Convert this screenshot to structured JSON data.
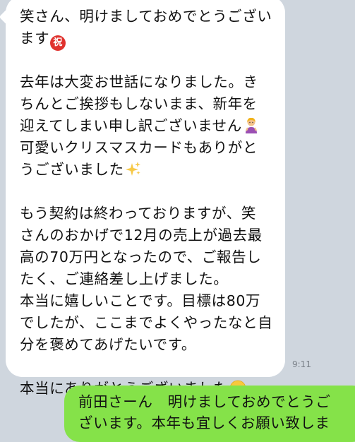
{
  "incoming": {
    "lines": [
      "笑さん、明けましておめでとうござい",
      "ます",
      "",
      "去年は大変お世話になりました。き",
      "ちんとご挨拶もしないまま、新年を",
      "迎えてしまい申し訳ございません",
      "可愛いクリスマスカードもありがと",
      "うございました",
      "",
      "もう契約は終わっておりますが、笑",
      "さんのおかげで12月の売上が過去最",
      "高の70万円となったので、ご報告し",
      "たく、ご連絡差し上げました。",
      "本当に嬉しいことです。目標は80万",
      "でしたが、ここまでよくやったなと自",
      "分を褒めてあげたいです。",
      "",
      "本当にありがとうございました"
    ],
    "emoji_celebrate_label": "祝",
    "timestamp": "9:11"
  },
  "outgoing": {
    "lines": [
      "前田さーん　明けましておめでとうご",
      "ざいます。本年も宜しくお願い致しま"
    ]
  },
  "colors": {
    "chat_background": "#cfd6de",
    "incoming_bubble": "#ffffff",
    "outgoing_bubble": "#85e249",
    "timestamp": "#7a8088"
  },
  "icons": [
    "celebrate-badge-icon",
    "apologizing-person-icon",
    "sparkles-icon",
    "smiling-face-icon"
  ]
}
